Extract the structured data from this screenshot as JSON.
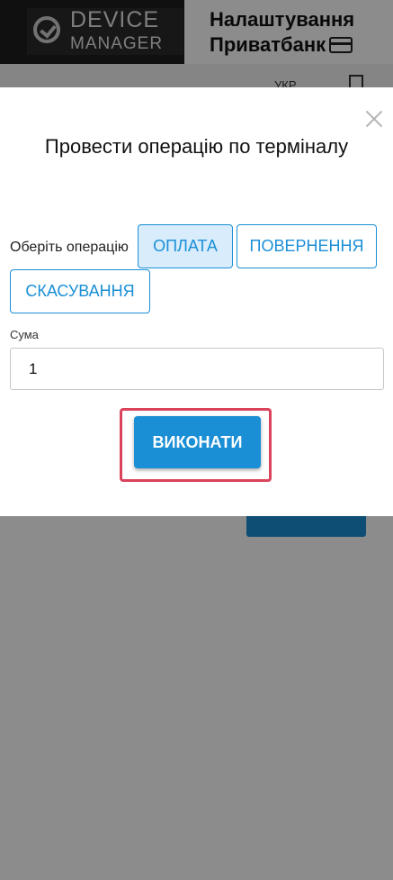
{
  "header": {
    "logo_line1": "DEVICE",
    "logo_line2": "MANAGER",
    "title_line1": "Налаштування",
    "title_line2": "Приватбанк"
  },
  "subbar": {
    "language": "УКР"
  },
  "modal": {
    "title": "Провести операцію по терміналу",
    "operation_label": "Оберіть операцію",
    "operations": [
      {
        "label": "ОПЛАТА",
        "selected": true
      },
      {
        "label": "ПОВЕРНЕННЯ",
        "selected": false
      },
      {
        "label": "СКАСУВАННЯ",
        "selected": false
      }
    ],
    "amount_label": "Сума",
    "amount_value": "1",
    "execute_label": "ВИКОНАТИ"
  },
  "colors": {
    "accent": "#1a8fd6",
    "highlight": "#d9435c",
    "selected_bg": "#d8ecfb"
  }
}
